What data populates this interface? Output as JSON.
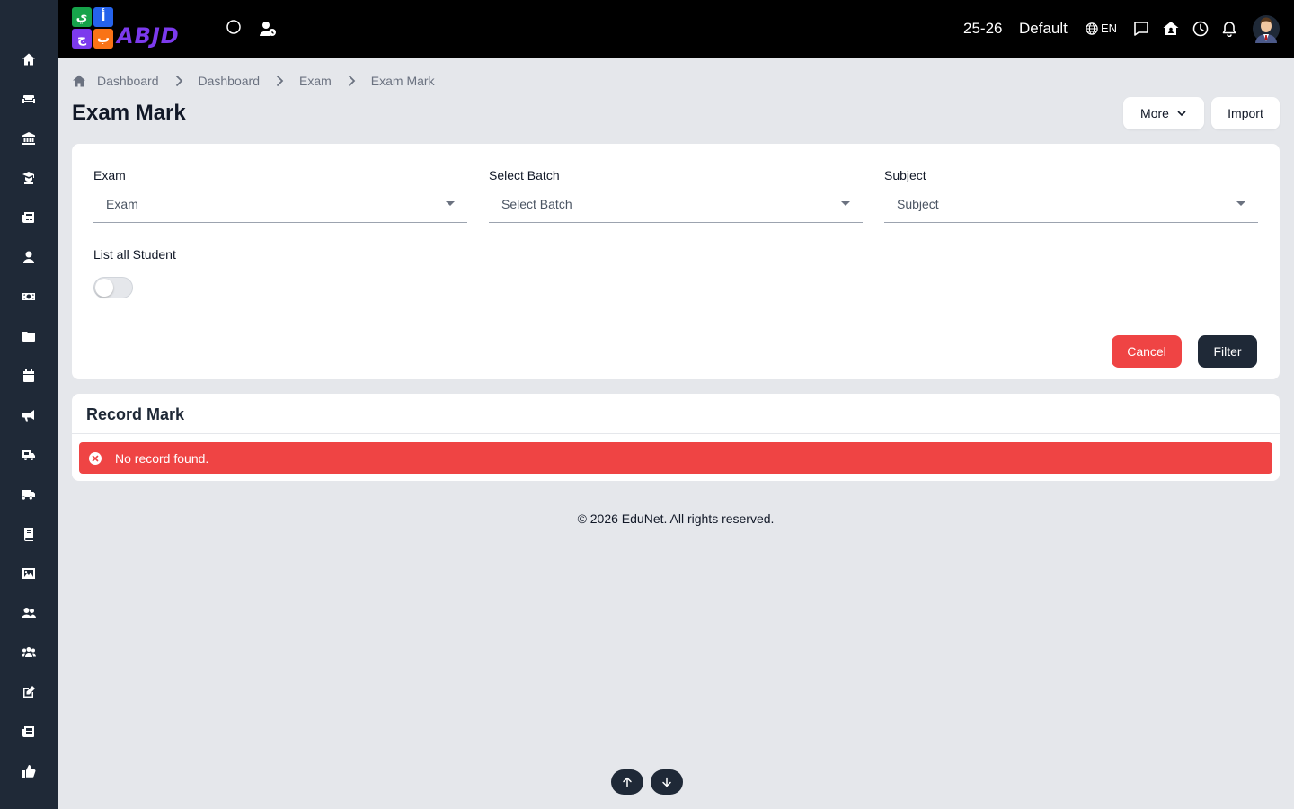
{
  "app": {
    "logo_text": "ABJD",
    "logo_tiles": [
      "ي",
      "أ",
      "ج",
      "ب"
    ],
    "colors": {
      "sidebar": "#1f2937",
      "topbar": "#000000",
      "danger": "#ef4444",
      "dark_button": "#1f2937",
      "background": "#e5e7eb"
    }
  },
  "sidebar": {
    "items": [
      {
        "icon": "home-icon"
      },
      {
        "icon": "couch-icon"
      },
      {
        "icon": "institution-icon"
      },
      {
        "icon": "graduate-icon"
      },
      {
        "icon": "newspaper-icon"
      },
      {
        "icon": "user-icon"
      },
      {
        "icon": "money-icon"
      },
      {
        "icon": "folder-icon"
      },
      {
        "icon": "calendar-icon"
      },
      {
        "icon": "megaphone-icon"
      },
      {
        "icon": "school-bus-icon"
      },
      {
        "icon": "truck-icon"
      },
      {
        "icon": "book-icon"
      },
      {
        "icon": "image-icon"
      },
      {
        "icon": "users-icon"
      },
      {
        "icon": "group-icon"
      },
      {
        "icon": "edit-icon"
      },
      {
        "icon": "news-icon"
      },
      {
        "icon": "thumbs-up-icon"
      }
    ]
  },
  "topbar": {
    "academic_year": "25-26",
    "profile": "Default",
    "language": "EN"
  },
  "breadcrumb": {
    "items": [
      "Dashboard",
      "Dashboard",
      "Exam"
    ],
    "current": "Exam Mark"
  },
  "page": {
    "title": "Exam Mark",
    "more_label": "More",
    "import_label": "Import"
  },
  "filters": {
    "exam": {
      "label": "Exam",
      "value": "Exam"
    },
    "batch": {
      "label": "Select Batch",
      "value": "Select Batch"
    },
    "subject": {
      "label": "Subject",
      "value": "Subject"
    },
    "list_all": {
      "label": "List all Student",
      "enabled": false
    },
    "cancel_label": "Cancel",
    "filter_label": "Filter"
  },
  "record": {
    "title": "Record Mark",
    "message": "No record found."
  },
  "footer": {
    "text": "© 2026 EduNet. All rights reserved."
  }
}
